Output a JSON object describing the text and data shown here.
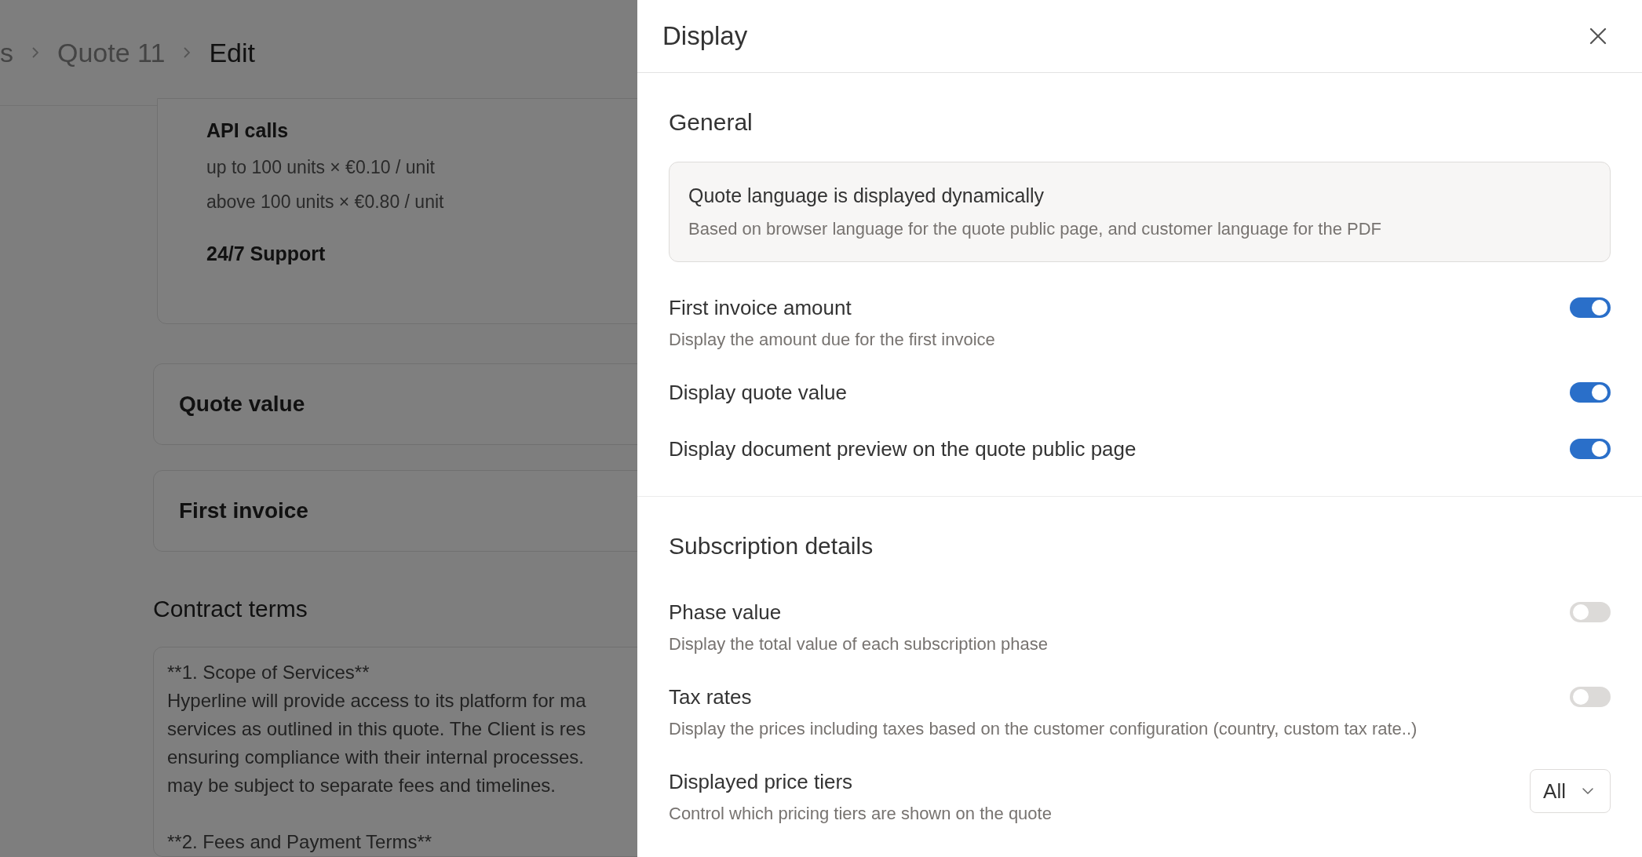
{
  "background": {
    "breadcrumb": [
      "s",
      "Quote 11",
      "Edit"
    ],
    "tiers": [
      {
        "kind": "heading",
        "text": "API calls"
      },
      {
        "kind": "line",
        "text": "up to 100 units × €0.10 / unit"
      },
      {
        "kind": "line",
        "text": "above 100 units × €0.80 / unit"
      },
      {
        "kind": "heading",
        "text": "24/7 Support"
      }
    ],
    "summary_cards": [
      "Quote value",
      "First invoice"
    ],
    "contract_terms": {
      "title": "Contract terms",
      "paragraphs": [
        [
          "**1. Scope of Services**",
          "Hyperline will provide access to its platform for ma",
          "services as outlined in this quote. The Client is res",
          "ensuring compliance with their internal processes.",
          "may be subject to separate fees and timelines."
        ],
        [
          "**2. Fees and Payment Terms**"
        ]
      ]
    }
  },
  "panel": {
    "title": "Display",
    "sections": [
      {
        "title": "General",
        "notice": {
          "title": "Quote language is displayed dynamically",
          "text": "Based on browser language for the quote public page, and customer language for the PDF"
        },
        "settings": [
          {
            "kind": "toggle",
            "label": "First invoice amount",
            "description": "Display the amount due for the first invoice",
            "on": true
          },
          {
            "kind": "toggle",
            "label": "Display quote value",
            "on": true
          },
          {
            "kind": "toggle",
            "label": "Display document preview on the quote public page",
            "on": true
          }
        ]
      },
      {
        "title": "Subscription details",
        "settings": [
          {
            "kind": "toggle",
            "label": "Phase value",
            "description": "Display the total value of each subscription phase",
            "on": false
          },
          {
            "kind": "toggle",
            "label": "Tax rates",
            "description": "Display the prices including taxes based on the customer configuration (country, custom tax rate..)",
            "on": false
          },
          {
            "kind": "select",
            "label": "Displayed price tiers",
            "description": "Control which pricing tiers are shown on the quote",
            "value": "All"
          }
        ]
      }
    ]
  }
}
